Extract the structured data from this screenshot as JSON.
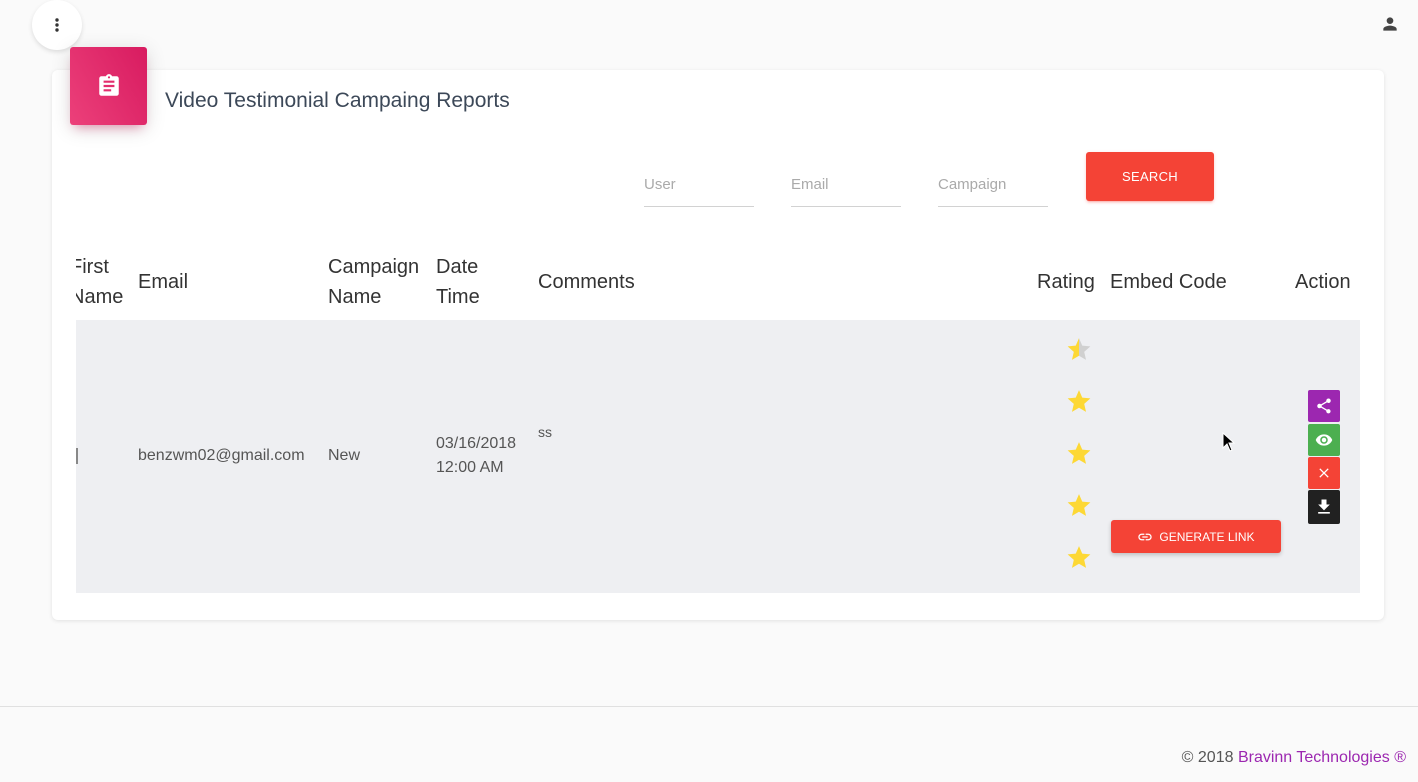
{
  "topbar": {
    "menu_icon": "more-vert-icon",
    "user_icon": "person-icon"
  },
  "card": {
    "icon": "assignment-icon",
    "title": "Video Testimonial Campaing Reports"
  },
  "filters": {
    "user_placeholder": "User",
    "email_placeholder": "Email",
    "campaign_placeholder": "Campaign",
    "search_label": "SEARCH"
  },
  "table": {
    "headers": {
      "first_name": [
        "First",
        "Name"
      ],
      "email": "Email",
      "campaign_name": [
        "Campaign",
        "Name"
      ],
      "date_time": [
        "Date",
        "Time"
      ],
      "comments": "Comments",
      "rating": "Rating",
      "embed_code": "Embed Code",
      "action": "Action"
    },
    "rows": [
      {
        "first_name": "",
        "email": "benzwm02@gmail.com",
        "campaign_name": "New",
        "date": "03/16/2018",
        "time": "12:00 AM",
        "comments": "ss",
        "rating": 4.5,
        "generate_link_label": "GENERATE LINK"
      }
    ]
  },
  "actions": [
    "share-icon",
    "view-icon",
    "delete-icon",
    "download-icon"
  ],
  "colors": {
    "accent_pink": "#e91e63",
    "danger_red": "#f44336",
    "share_purple": "#9c27b0",
    "view_green": "#4caf50",
    "download_dark": "#212121",
    "star_gold": "#fdd835",
    "link_purple": "#9c27b0"
  },
  "footer": {
    "copyright_prefix": "© 2018",
    "company": "Bravinn Technologies ®"
  }
}
